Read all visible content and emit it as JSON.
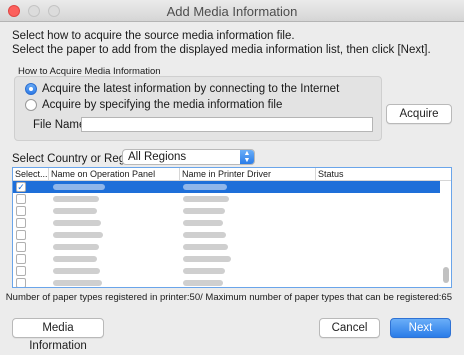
{
  "window": {
    "title": "Add Media Information"
  },
  "instructions": {
    "line1": "Select how to acquire the source media information file.",
    "line2": "Select the paper to add from the displayed media information list, then click [Next]."
  },
  "acquire_group": {
    "label": "How to Acquire Media Information",
    "option1": "Acquire the latest information by connecting to the Internet",
    "option2": "Acquire by specifying the media information file",
    "selected_option": 1,
    "file_name_label": "File Name:",
    "file_name_value": ""
  },
  "acquire_button": "Acquire",
  "country": {
    "label": "Select Country or Region",
    "selected": "All Regions"
  },
  "table": {
    "headers": [
      "Select...",
      "Name on Operation Panel",
      "Name in Printer Driver",
      "Status"
    ],
    "rows": [
      {
        "checked": true,
        "selected": true
      },
      {
        "checked": false,
        "selected": false
      },
      {
        "checked": false,
        "selected": false
      },
      {
        "checked": false,
        "selected": false
      },
      {
        "checked": false,
        "selected": false
      },
      {
        "checked": false,
        "selected": false
      },
      {
        "checked": false,
        "selected": false
      },
      {
        "checked": false,
        "selected": false
      },
      {
        "checked": false,
        "selected": false
      }
    ]
  },
  "count_text": "Number of paper types registered in printer:50/ Maximum number of paper types that can be registered:65",
  "buttons": {
    "media_info": "Media Information",
    "cancel": "Cancel",
    "next": "Next"
  },
  "colors": {
    "accent": "#1e6fd9",
    "close": "#fc605c",
    "background": "#ececec"
  }
}
